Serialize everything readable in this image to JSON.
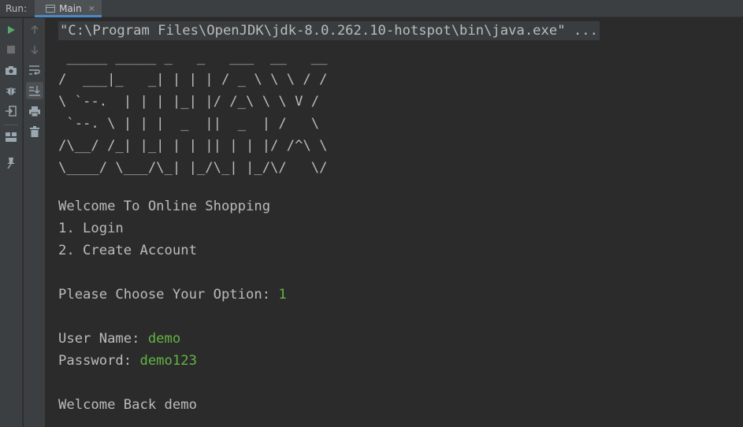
{
  "tabbar": {
    "run_label": "Run:",
    "tab_label": "Main",
    "tab_close": "×"
  },
  "toolbar": {
    "left_icons": [
      "run-icon",
      "stop-icon",
      "camera-icon",
      "bug-icon",
      "login-icon",
      "layout-icon",
      "pin-icon"
    ],
    "right_icons": [
      "arrow-up-icon",
      "arrow-down-icon",
      "soft-wrap-icon",
      "scroll-to-end-icon",
      "print-icon",
      "trash-icon"
    ],
    "colors": {
      "run": "#59a869",
      "icon": "#9aa7b0",
      "active_bg": "#4c5052"
    }
  },
  "console": {
    "command": "\"C:\\Program Files\\OpenJDK\\jdk-8.0.262.10-hotspot\\bin\\java.exe\" ...",
    "ascii_art": [
      " _____ _____ _   _   ___  __   __",
      "/  ___|_   _| | | | / _ \\ \\ \\ / /",
      "\\ `--.  | | | |_| |/ /_\\ \\ \\ V /",
      " `--. \\ | | |  _  ||  _  | /   \\",
      "/\\__/ /_| |_| | | || | | |/ /^\\ \\",
      "\\____/ \\___/\\_| |_/\\_| |_/\\/   \\/"
    ],
    "welcome": "Welcome To Online Shopping",
    "option1": "1. Login",
    "option2": "2. Create Account",
    "choose_prompt": "Please Choose Your Option: ",
    "choose_value": "1",
    "username_prompt": "User Name: ",
    "username_value": "demo",
    "password_prompt": "Password: ",
    "password_value": "demo123",
    "welcome_back": "Welcome Back demo",
    "colors": {
      "text": "#bbbbbb",
      "user_input": "#62b543",
      "background": "#2b2b2b"
    }
  }
}
